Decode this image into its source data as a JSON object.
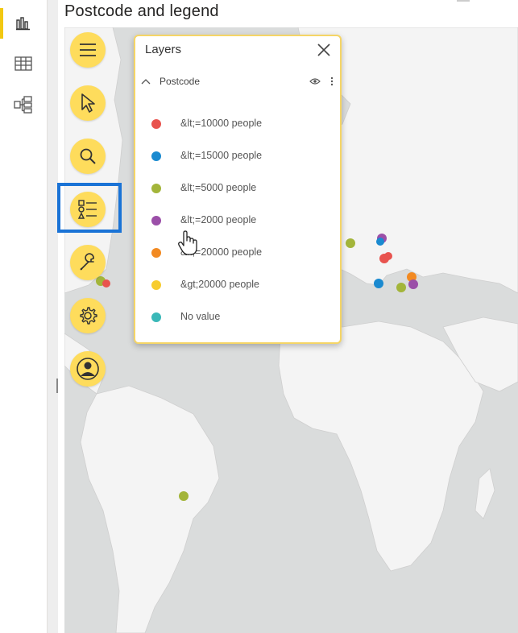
{
  "visual": {
    "title": "Postcode and legend"
  },
  "rail": {
    "items": [
      {
        "icon": "report-view-icon"
      },
      {
        "icon": "table-view-icon"
      },
      {
        "icon": "model-view-icon"
      }
    ]
  },
  "toolbar": {
    "items": [
      {
        "icon": "hamburger-menu-icon"
      },
      {
        "icon": "pointer-select-icon"
      },
      {
        "icon": "search-icon"
      },
      {
        "icon": "legend-icon"
      },
      {
        "icon": "wrench-icon"
      },
      {
        "icon": "gear-icon"
      },
      {
        "icon": "user-icon"
      }
    ]
  },
  "layers_panel": {
    "title": "Layers",
    "layer": {
      "name": "Postcode"
    },
    "legend": [
      {
        "label": "&lt;=10000 people",
        "color": "#e8534e"
      },
      {
        "label": "&lt;=15000 people",
        "color": "#1a8ad0"
      },
      {
        "label": "&lt;=5000 people",
        "color": "#a3b53a"
      },
      {
        "label": "&lt;=2000 people",
        "color": "#9b4fa8"
      },
      {
        "label": "&lt;=20000 people",
        "color": "#f28a22"
      },
      {
        "label": "&gt;20000 people",
        "color": "#f7cc2f"
      },
      {
        "label": "No value",
        "color": "#3ab8b8"
      }
    ]
  },
  "colors": {
    "accent": "#fedc5c",
    "highlight": "#1a73d6",
    "map_land": "#f4f4f4",
    "map_water": "#dadcdc"
  }
}
